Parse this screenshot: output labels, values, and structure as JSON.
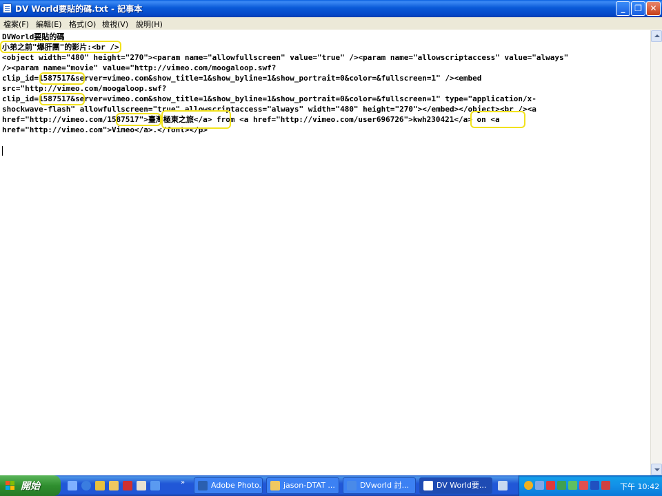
{
  "window": {
    "title": "DV World要貼的碼.txt - 記事本"
  },
  "menu": [
    "檔案(F)",
    "編輯(E)",
    "格式(O)",
    "檢視(V)",
    "說明(H)"
  ],
  "editor": {
    "lines": [
      "DVWorld要貼的碼",
      "小弟之前\"爆肝團\"的影片:<br />",
      "<object width=\"480\" height=\"270\"><param name=\"allowfullscreen\" value=\"true\" /><param name=\"allowscriptaccess\" value=\"always\"",
      "/><param name=\"movie\" value=\"http://vimeo.com/moogaloop.swf?",
      "clip_id=1587517&server=vimeo.com&show_title=1&show_byline=1&show_portrait=0&color=&fullscreen=1\" /><embed",
      "src=\"http://vimeo.com/moogaloop.swf?",
      "clip_id=1587517&server=vimeo.com&show_title=1&show_byline=1&show_portrait=0&color=&fullscreen=1\" type=\"application/x-",
      "shockwave-flash\" allowfullscreen=\"true\" allowscriptaccess=\"always\" width=\"480\" height=\"270\"></embed></object><br /><a",
      "href=\"http://vimeo.com/1587517\">臺灣極東之旅</a> from <a href=\"http://vimeo.com/user696726\">kwh230421</a> on <a",
      "href=\"http://vimeo.com\">Vimeo</a>.</font></p>"
    ]
  },
  "taskbar": {
    "start_label": "開始",
    "tasks": [
      "Adobe Photo...",
      "jason-DTAT ...",
      "DVworld 討...",
      "DV World要..."
    ],
    "clock": "下午 10:42"
  }
}
